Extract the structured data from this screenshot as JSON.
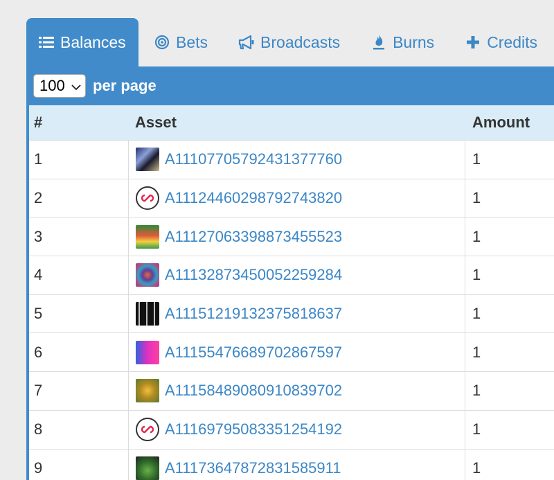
{
  "tabs": [
    {
      "label": "Balances",
      "icon": "list-icon",
      "active": true
    },
    {
      "label": "Bets",
      "icon": "bullseye-icon",
      "active": false
    },
    {
      "label": "Broadcasts",
      "icon": "bullhorn-icon",
      "active": false
    },
    {
      "label": "Burns",
      "icon": "fire-icon",
      "active": false
    },
    {
      "label": "Credits",
      "icon": "plus-icon",
      "active": false
    }
  ],
  "pager": {
    "selected": "100",
    "per_page_label": "per page"
  },
  "table": {
    "headers": {
      "num": "#",
      "asset": "Asset",
      "amount": "Amount"
    },
    "rows": [
      {
        "num": "1",
        "asset": "A11107705792431377760",
        "amount": "1",
        "thumb": "thumb-blue-mech"
      },
      {
        "num": "2",
        "asset": "A11124460298792743820",
        "amount": "1",
        "thumb": "circle-link-icon"
      },
      {
        "num": "3",
        "asset": "A11127063398873455523",
        "amount": "1",
        "thumb": "thumb-green-red"
      },
      {
        "num": "4",
        "asset": "A11132873450052259284",
        "amount": "1",
        "thumb": "thumb-psychedelic"
      },
      {
        "num": "5",
        "asset": "A11151219132375818637",
        "amount": "1",
        "thumb": "thumb-dark-slots"
      },
      {
        "num": "6",
        "asset": "A11155476689702867597",
        "amount": "1",
        "thumb": "thumb-magenta"
      },
      {
        "num": "7",
        "asset": "A11158489080910839702",
        "amount": "1",
        "thumb": "thumb-gold"
      },
      {
        "num": "8",
        "asset": "A11169795083351254192",
        "amount": "1",
        "thumb": "circle-link-icon"
      },
      {
        "num": "9",
        "asset": "A11173647872831585911",
        "amount": "1",
        "thumb": "thumb-green-face"
      }
    ]
  },
  "colors": {
    "accent": "#428bca",
    "link": "#3c87c6",
    "header_bg": "#d9ecf7"
  }
}
